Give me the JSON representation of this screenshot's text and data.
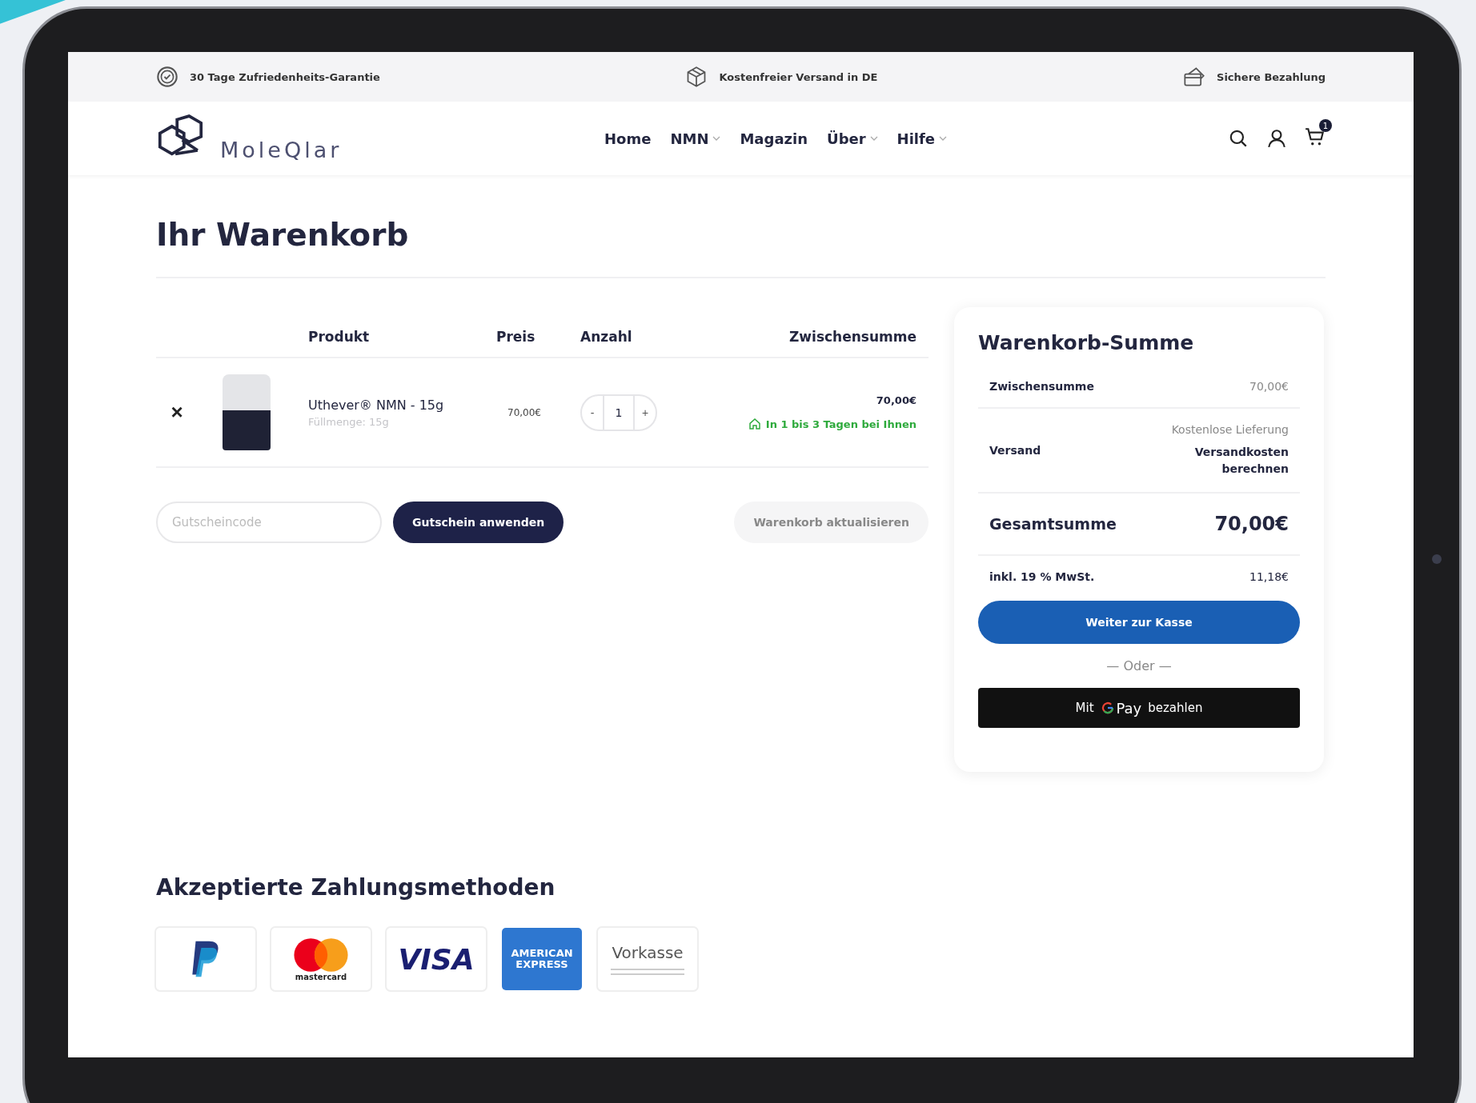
{
  "top_bar": [
    {
      "kind": "guarantee",
      "text": "30 Tage Zufriedenheits-Garantie"
    },
    {
      "kind": "shipping",
      "text": "Kostenfreier Versand in DE"
    },
    {
      "kind": "payment",
      "text": "Sichere Bezahlung"
    }
  ],
  "header": {
    "logo_text": "MoleQlar",
    "nav": [
      {
        "label": "Home",
        "dropdown": false
      },
      {
        "label": "NMN",
        "dropdown": true
      },
      {
        "label": "Magazin",
        "dropdown": false
      },
      {
        "label": "Über",
        "dropdown": true
      },
      {
        "label": "Hilfe",
        "dropdown": true
      }
    ],
    "cart_count": "1"
  },
  "page_title": "Ihr Warenkorb",
  "cart_table": {
    "columns": [
      "Produkt",
      "Preis",
      "Anzahl",
      "Zwischensumme"
    ],
    "rows": [
      {
        "remove": "×",
        "name": "Uthever® NMN - 15g",
        "variant": "Füllmenge: 15g",
        "price": "70,00€",
        "quantity": "1",
        "minus": "-",
        "plus": "+",
        "subtotal": "70,00€",
        "delivery": "In 1 bis 3 Tagen bei Ihnen"
      }
    ]
  },
  "coupon": {
    "placeholder": "Gutscheincode",
    "apply_button": "Gutschein anwenden",
    "update_button": "Warenkorb aktualisieren"
  },
  "summary": {
    "title": "Warenkorb-Summe",
    "subtotal_label": "Zwischensumme",
    "subtotal": "70,00€",
    "shipping_label": "Versand",
    "shipping_option": "Kostenlose Lieferung",
    "shipping_link": "Versandkosten berechnen",
    "total_label": "Gesamtsumme",
    "total": "70,00€",
    "tax_label": "inkl. 19 % MwSt.",
    "tax": "11,18€",
    "checkout_button": "Weiter zur Kasse",
    "or_text": "— Oder —",
    "gpay_prefix": "Mit",
    "gpay_brand": "Pay",
    "gpay_suffix": "bezahlen"
  },
  "payment_methods": {
    "title": "Akzeptierte Zahlungsmethoden",
    "items": [
      {
        "kind": "paypal"
      },
      {
        "kind": "mastercard",
        "label": "mastercard"
      },
      {
        "kind": "visa",
        "label": "VISA"
      },
      {
        "kind": "amex",
        "label": "AMERICAN EXPRESS"
      },
      {
        "kind": "text",
        "label": "Vorkasse"
      }
    ]
  }
}
